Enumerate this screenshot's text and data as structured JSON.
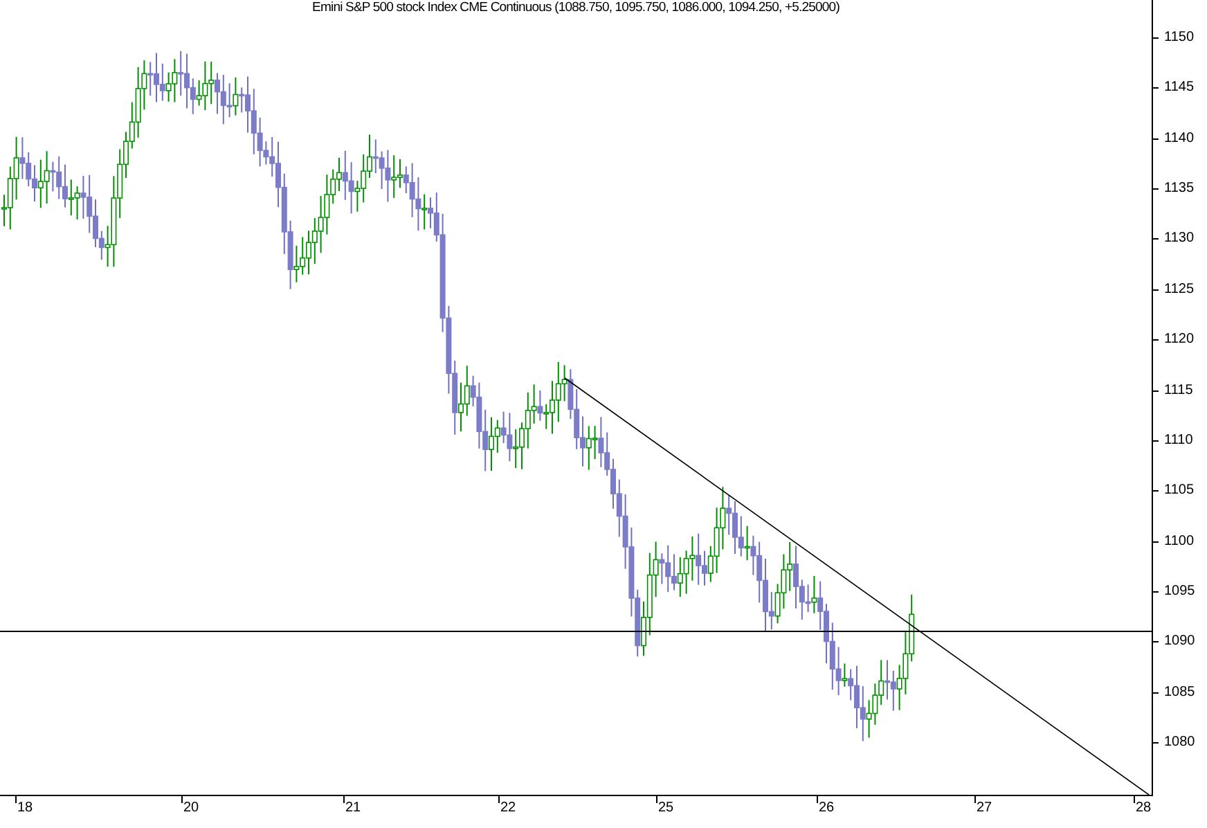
{
  "title": "Emini S&P 500 stock Index CME Continuous (1088.750, 1095.750, 1086.000, 1094.250, +5.25000)",
  "y_axis": {
    "ticks": [
      "1150",
      "1145",
      "1140",
      "1135",
      "1130",
      "1125",
      "1120",
      "1115",
      "1110",
      "1105",
      "1100",
      "1095",
      "1090",
      "1085",
      "1080"
    ]
  },
  "x_axis": {
    "ticks": [
      "18",
      "20",
      "21",
      "22",
      "25",
      "26",
      "27",
      "28"
    ]
  }
}
